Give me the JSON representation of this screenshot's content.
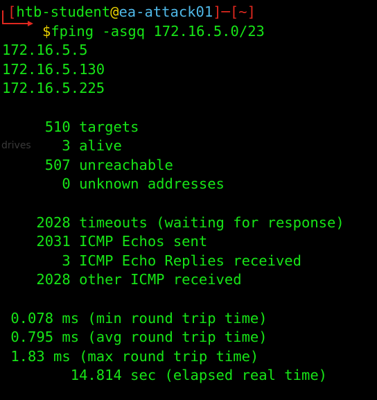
{
  "prompt": {
    "open_bracket": "┌─[",
    "user": "htb-student",
    "at": "@",
    "host": "ea-attack01",
    "sep": "]─[",
    "cwd": "~",
    "close_bracket": "]",
    "dollar": "$",
    "command": "fping -asgq 172.16.5.0/23"
  },
  "hosts": [
    "172.16.5.5",
    "172.16.5.130",
    "172.16.5.225"
  ],
  "stats_block1": [
    "     510 targets",
    "       3 alive",
    "     507 unreachable",
    "       0 unknown addresses"
  ],
  "stats_block2": [
    "    2028 timeouts (waiting for response)",
    "    2031 ICMP Echos sent",
    "       3 ICMP Echo Replies received",
    "    2028 other ICMP received"
  ],
  "stats_block3": [
    " 0.078 ms (min round trip time)",
    " 0.795 ms (avg round trip time)",
    " 1.83 ms (max round trip time)",
    "        14.814 sec (elapsed real time)"
  ],
  "background_ghost": {
    "drives": "drives"
  },
  "colors": {
    "background": "#000000",
    "output_green": "#17e517",
    "prompt_red": "#e0281f",
    "at_yellow": "#e8d000",
    "host_blue": "#4fb7e6"
  }
}
